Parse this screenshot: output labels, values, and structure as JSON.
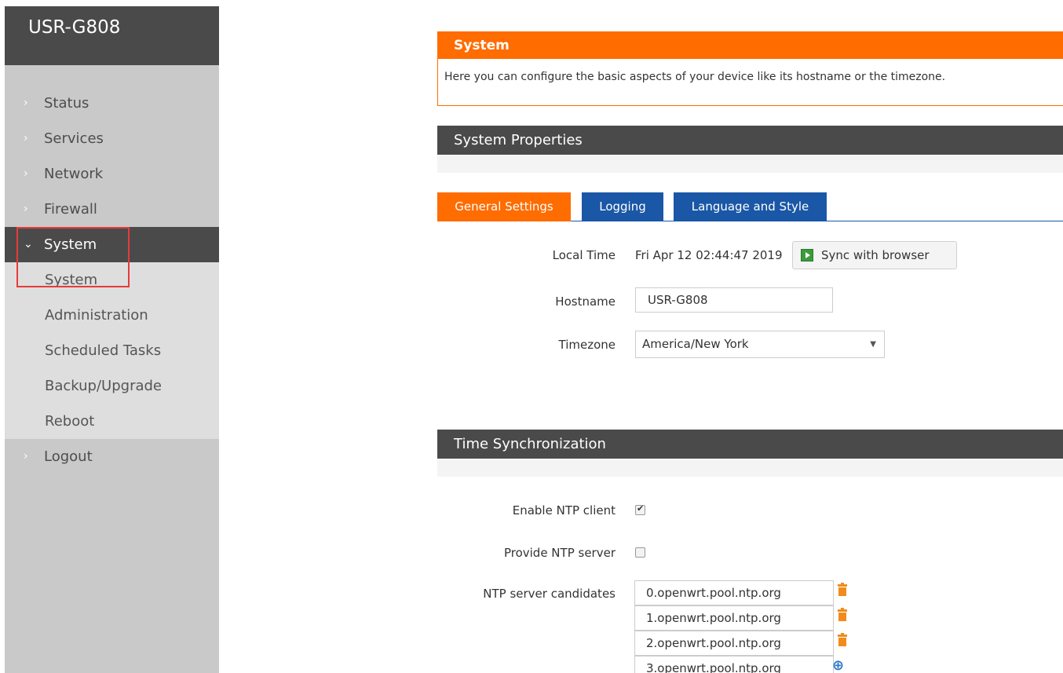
{
  "sidebar": {
    "brand": "USR-G808",
    "items": [
      {
        "label": "Status"
      },
      {
        "label": "Services"
      },
      {
        "label": "Network"
      },
      {
        "label": "Firewall"
      },
      {
        "label": "System"
      },
      {
        "label": "Logout"
      }
    ],
    "system_submenu": [
      "System",
      "Administration",
      "Scheduled Tasks",
      "Backup/Upgrade",
      "Reboot"
    ]
  },
  "intro": {
    "title": "System",
    "description": "Here you can configure the basic aspects of your device like its hostname or the timezone."
  },
  "system_properties": {
    "title": "System Properties",
    "tabs": [
      {
        "label": "General Settings",
        "active": true
      },
      {
        "label": "Logging",
        "active": false
      },
      {
        "label": "Language and Style",
        "active": false
      }
    ],
    "local_time_label": "Local Time",
    "local_time_value": "Fri Apr 12 02:44:47 2019",
    "sync_button": "Sync with browser",
    "hostname_label": "Hostname",
    "hostname_value": "USR-G808",
    "timezone_label": "Timezone",
    "timezone_value": "America/New York"
  },
  "time_sync": {
    "title": "Time Synchronization",
    "enable_ntp_label": "Enable NTP client",
    "enable_ntp_checked": true,
    "provide_ntp_label": "Provide NTP server",
    "provide_ntp_checked": false,
    "candidates_label": "NTP server candidates",
    "candidates": [
      "0.openwrt.pool.ntp.org",
      "1.openwrt.pool.ntp.org",
      "2.openwrt.pool.ntp.org",
      "3.openwrt.pool.ntp.org"
    ]
  },
  "colors": {
    "accent": "#ff6c00",
    "tab_blue": "#1a57a6",
    "header_dark": "#4a4a4a",
    "highlight_red": "#e83b3b"
  }
}
